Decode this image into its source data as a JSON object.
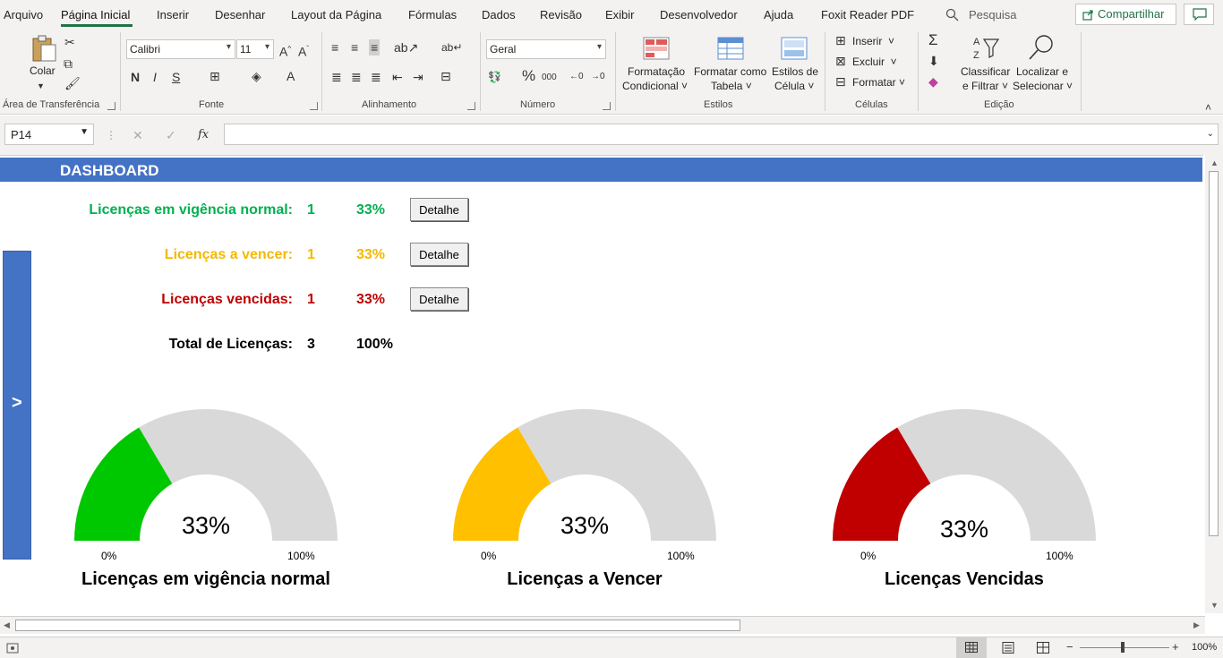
{
  "menu": {
    "items": [
      "Arquivo",
      "Página Inicial",
      "Inserir",
      "Desenhar",
      "Layout da Página",
      "Fórmulas",
      "Dados",
      "Revisão",
      "Exibir",
      "Desenvolvedor",
      "Ajuda",
      "Foxit Reader PDF"
    ],
    "search": "Pesquisa",
    "share": "Compartilhar"
  },
  "ribbon": {
    "clipboard": {
      "paste": "Colar",
      "label": "Área de Transferência"
    },
    "font": {
      "name": "Calibri",
      "size": "11",
      "bold": "N",
      "italic": "I",
      "underline": "S",
      "label": "Fonte"
    },
    "alignment": {
      "label": "Alinhamento"
    },
    "number": {
      "format": "Geral",
      "label": "Número"
    },
    "styles": {
      "cond_a": "Formatação",
      "cond_b": "Condicional",
      "table_a": "Formatar como",
      "table_b": "Tabela",
      "cell_a": "Estilos de",
      "cell_b": "Célula",
      "label": "Estilos"
    },
    "cells": {
      "insert": "Inserir",
      "delete": "Excluir",
      "format": "Formatar",
      "label": "Células"
    },
    "editing": {
      "sort_a": "Classificar",
      "sort_b": "e Filtrar",
      "find_a": "Localizar e",
      "find_b": "Selecionar",
      "label": "Edição"
    }
  },
  "formula_bar": {
    "name_box": "P14",
    "fx": "fx",
    "value": ""
  },
  "dashboard": {
    "title": "DASHBOARD",
    "toggle": ">",
    "stats": [
      {
        "label": "Licenças em vigência normal:",
        "count": "1",
        "pct": "33%",
        "button": "Detalhe",
        "color": "#00b050"
      },
      {
        "label": "Licenças a vencer:",
        "count": "1",
        "pct": "33%",
        "button": "Detalhe",
        "color": "#f5b800"
      },
      {
        "label": "Licenças vencidas:",
        "count": "1",
        "pct": "33%",
        "button": "Detalhe",
        "color": "#c00000"
      },
      {
        "label": "Total de Licenças:",
        "count": "3",
        "pct": "100%",
        "color": "#000000"
      }
    ]
  },
  "chart_data": [
    {
      "type": "gauge",
      "title": "Licenças em vigência normal",
      "value": 33,
      "value_label": "33%",
      "min_label": "0%",
      "max_label": "100%",
      "range": [
        0,
        100
      ],
      "color": "#00c800",
      "track_color": "#d9d9d9"
    },
    {
      "type": "gauge",
      "title": "Licenças a Vencer",
      "value": 33,
      "value_label": "33%",
      "min_label": "0%",
      "max_label": "100%",
      "range": [
        0,
        100
      ],
      "color": "#ffc000",
      "track_color": "#d9d9d9"
    },
    {
      "type": "gauge",
      "title": "Licenças Vencidas",
      "value": 33,
      "value_label": "33%",
      "min_label": "0%",
      "max_label": "100%",
      "range": [
        0,
        100
      ],
      "color": "#c00000",
      "track_color": "#d9d9d9"
    }
  ],
  "status": {
    "zoom": "100%"
  }
}
